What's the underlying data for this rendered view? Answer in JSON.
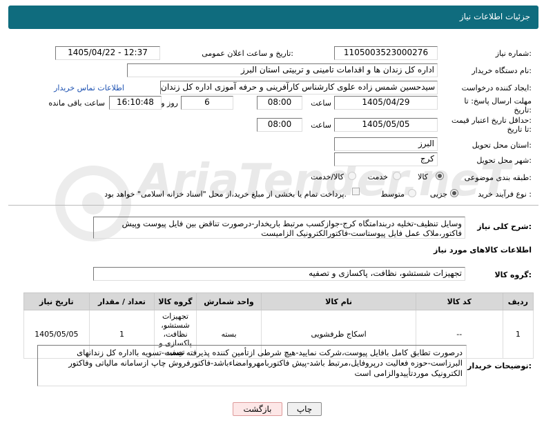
{
  "header": {
    "title": "جزئیات اطلاعات نیاز"
  },
  "fields": {
    "need_number_label": "شماره نیاز:",
    "need_number": "1105003523000276",
    "announce_label": "تاریخ و ساعت اعلان عمومی:",
    "announce_value": "1405/04/22 - 12:37",
    "buyer_org_label": "نام دستگاه خریدار:",
    "buyer_org": "اداره کل زندان ها و اقدامات تامینی و تربیتی استان البرز",
    "creator_label": "ایجاد کننده درخواست:",
    "creator": "سیدحسین شمس زاده علوی کارشناس کارآفرینی و حرفه آموزی اداره کل زندان",
    "contact_link": "اطلاعات تماس خریدار",
    "send_deadline_label_1": "مهلت ارسال پاسخ: تا",
    "send_deadline_label_2": "تاریخ:",
    "send_date": "1405/04/29",
    "time_word": "ساعت",
    "send_time": "08:00",
    "days_value": "6",
    "days_word": "روز و",
    "remaining_time": "16:10:48",
    "remaining_word": "ساعت باقی مانده",
    "price_valid_label_1": "حداقل تاریخ اعتبار قیمت:",
    "price_valid_label_2": "تا تاریخ:",
    "valid_date": "1405/05/05",
    "valid_time": "08:00",
    "province_label": "استان محل تحویل:",
    "province": "البرز",
    "city_label": "شهر محل تحویل:",
    "city": "کرج",
    "category_label": "طبقه بندی موضوعی:",
    "category_options": [
      "کالا",
      "خدمت",
      "کالا/خدمت"
    ],
    "process_label": "نوع فرآیند خرید :",
    "process_options": [
      "جزیی",
      "متوسط"
    ],
    "payment_text": "پرداخت تمام یا بخشی از مبلغ خرید،از محل \"اسناد خزانه اسلامی\" خواهد بود."
  },
  "summary": {
    "label": "شرح کلی نیاز:",
    "text": "وسایل تنظیف-تخلیه دربندامتگاه کرج-جوازکسب مرتبط باریخدار-درصورت تناقض بین فایل پیوست وپیش فاکتور،ملاک عمل فایل پیوستاست-فاکتورالکترونیک الزامیست"
  },
  "goods_section": {
    "title": "اطلاعات کالاهای مورد نیاز",
    "group_label": "گروه کالا:",
    "group_value": "تجهیزات شستشو، نظافت، پاکسازی و تصفیه"
  },
  "table": {
    "headers": [
      "ردیف",
      "کد کالا",
      "نام کالا",
      "واحد شمارش",
      "گروه کالا",
      "تعداد / مقدار",
      "تاریخ نیاز"
    ],
    "rows": [
      {
        "row": "1",
        "code": "--",
        "name": "اسکاج ظرفشویی",
        "unit": "بسته",
        "group": "تجهیزات شستشو، نظافت، پاکسازی و تصفیه",
        "qty": "1",
        "date": "1405/05/05"
      }
    ]
  },
  "notes": {
    "label": "توضیحات خریدار:",
    "text": "درصورت تطابق کامل بافایل پیوست،شرکت نمایید-هیچ شرطی ازتأمین کننده پذیرفته نیست-تسویه بااداره کل زندانهای البرزاست-حوزه فعالیت درپروفایل،مرتبط باشد-پیش فاکتوربامهروامضاءباشد-فاکتورفروش چاپ ازسامانه مالیاتی وفاکتور الکترونیک موردتأییدوالزامی است"
  },
  "buttons": {
    "back": "بازگشت",
    "print": "چاپ"
  },
  "watermark": "AriaTender.neT",
  "colors": {
    "header_bg": "#0f6c7e",
    "link": "#1a4fb0",
    "back_button_bg": "#fde7e7"
  }
}
